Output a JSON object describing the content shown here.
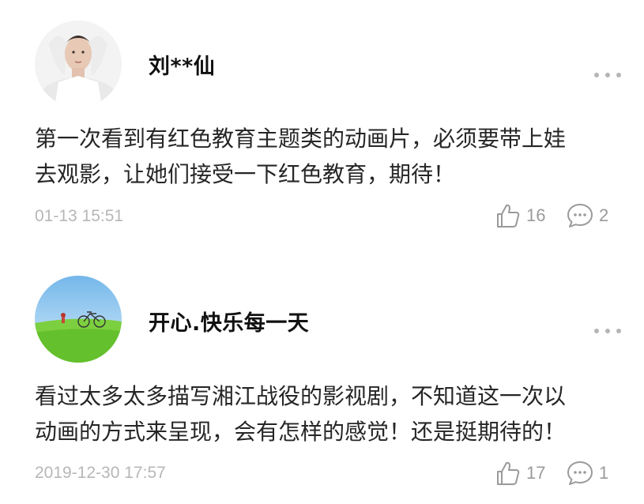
{
  "comments": [
    {
      "username": "刘**仙",
      "avatar_icon": "avatar-man-white-shirt",
      "content_lines": [
        "第一次看到有红色教育主题类的动画片，必须要带上娃",
        "去观影，让她们接受一下红色教育，期待！"
      ],
      "timestamp": "01-13 15:51",
      "likes": "16",
      "replies": "2"
    },
    {
      "username": "开心.快乐每一天",
      "avatar_icon": "avatar-bicycle-meadow",
      "content_lines": [
        "看过太多太多描写湘江战役的影视剧，不知道这一次以",
        "动画的方式来呈现，会有怎样的感觉！还是挺期待的！"
      ],
      "timestamp": "2019-12-30 17:57",
      "likes": "17",
      "replies": "1"
    }
  ],
  "icons": {
    "more": "more-dots-icon",
    "like": "thumbs-up-icon",
    "reply": "comment-bubble-icon"
  },
  "colors": {
    "meta_gray": "#b7b7b7",
    "icon_gray": "#9a9a9a",
    "text": "#262626"
  }
}
